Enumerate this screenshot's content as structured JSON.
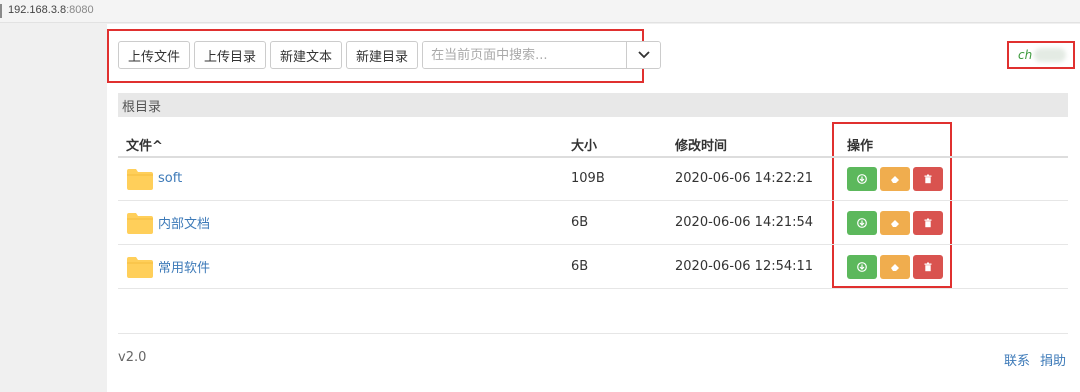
{
  "browser": {
    "url_host": "192.168.3.8",
    "url_port": ":8080"
  },
  "toolbar": {
    "upload_file": "上传文件",
    "upload_dir": "上传目录",
    "new_text": "新建文本",
    "new_dir": "新建目录",
    "search_placeholder": "在当前页面中搜索..."
  },
  "user": {
    "name": "ch"
  },
  "breadcrumb": "根目录",
  "table": {
    "headers": {
      "name": "文件^",
      "size": "大小",
      "modified": "修改时间",
      "actions": "操作"
    },
    "rows": [
      {
        "name": "soft",
        "size": "109B",
        "modified": "2020-06-06 14:22:21"
      },
      {
        "name": "内部文档",
        "size": "6B",
        "modified": "2020-06-06 14:21:54"
      },
      {
        "name": "常用软件",
        "size": "6B",
        "modified": "2020-06-06 12:54:11"
      }
    ]
  },
  "footer": {
    "version": "v2.0",
    "contact": "联系",
    "donate": "捐助"
  },
  "colors": {
    "highlight": "#e0302f",
    "download": "#5cb85c",
    "edit": "#f0ad4e",
    "delete": "#d9534f",
    "link": "#3d7ab8",
    "folder": "#ffcf5a"
  }
}
